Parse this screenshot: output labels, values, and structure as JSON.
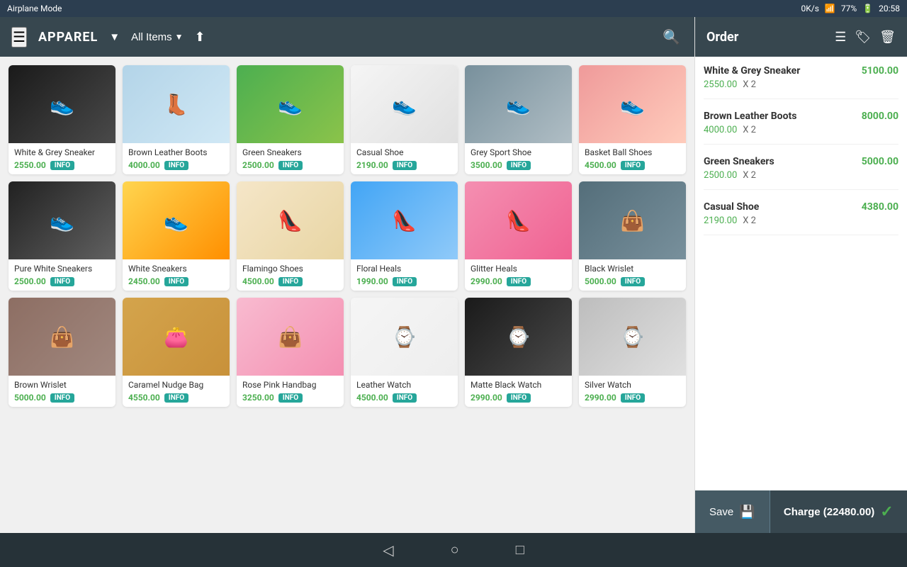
{
  "statusBar": {
    "left": "Airplane Mode",
    "right": {
      "network": "0K/s",
      "wifi": "wifi",
      "signal": "signal",
      "battery": "77%",
      "time": "20:58"
    }
  },
  "topBar": {
    "brand": "APPAREL",
    "dropdown1": "All Items",
    "uploadIcon": "⬆",
    "searchIcon": "🔍"
  },
  "orderPanel": {
    "title": "Order",
    "items": [
      {
        "name": "White & Grey Sneaker",
        "price": "2550.00",
        "qty": "X 2",
        "total": "5100.00"
      },
      {
        "name": "Brown Leather Boots",
        "price": "4000.00",
        "qty": "X 2",
        "total": "8000.00"
      },
      {
        "name": "Green Sneakers",
        "price": "2500.00",
        "qty": "X 2",
        "total": "5000.00"
      },
      {
        "name": "Casual Shoe",
        "price": "2190.00",
        "qty": "X 2",
        "total": "4380.00"
      }
    ],
    "saveLabel": "Save",
    "chargeLabel": "Charge (22480.00)"
  },
  "products": [
    {
      "name": "White & Grey Sneaker",
      "price": "2550.00",
      "imgClass": "img-dark",
      "emoji": "👟"
    },
    {
      "name": "Brown Leather Boots",
      "price": "4000.00",
      "imgClass": "img-light-blue",
      "emoji": "👢"
    },
    {
      "name": "Green Sneakers",
      "price": "2500.00",
      "imgClass": "img-green",
      "emoji": "👟"
    },
    {
      "name": "Casual Shoe",
      "price": "2190.00",
      "imgClass": "img-white",
      "emoji": "👟"
    },
    {
      "name": "Grey Sport Shoe",
      "price": "3500.00",
      "imgClass": "img-grey",
      "emoji": "👟"
    },
    {
      "name": "Basket Ball Shoes",
      "price": "4500.00",
      "imgClass": "img-red-white",
      "emoji": "👟"
    },
    {
      "name": "Pure White Sneakers",
      "price": "2500.00",
      "imgClass": "img-black",
      "emoji": "👟"
    },
    {
      "name": "White Sneakers",
      "price": "2450.00",
      "imgClass": "img-yellow",
      "emoji": "👟"
    },
    {
      "name": "Flamingo Shoes",
      "price": "4500.00",
      "imgClass": "img-cream",
      "emoji": "👠"
    },
    {
      "name": "Floral Heals",
      "price": "1990.00",
      "imgClass": "img-blue",
      "emoji": "👠"
    },
    {
      "name": "Glitter Heals",
      "price": "2990.00",
      "imgClass": "img-pink",
      "emoji": "👠"
    },
    {
      "name": "Black Wrislet",
      "price": "5000.00",
      "imgClass": "img-dark-grey",
      "emoji": "👜"
    },
    {
      "name": "Brown Wrislet",
      "price": "5000.00",
      "imgClass": "img-brown",
      "emoji": "👜"
    },
    {
      "name": "Caramel Nudge Bag",
      "price": "4550.00",
      "imgClass": "img-caramel",
      "emoji": "👛"
    },
    {
      "name": "Rose Pink Handbag",
      "price": "3250.00",
      "imgClass": "img-rose",
      "emoji": "👜"
    },
    {
      "name": "Leather Watch",
      "price": "4500.00",
      "imgClass": "img-marble",
      "emoji": "⌚"
    },
    {
      "name": "Matte Black Watch",
      "price": "2990.00",
      "imgClass": "img-dark",
      "emoji": "⌚"
    },
    {
      "name": "Silver Watch",
      "price": "2990.00",
      "imgClass": "img-silver",
      "emoji": "⌚"
    }
  ]
}
